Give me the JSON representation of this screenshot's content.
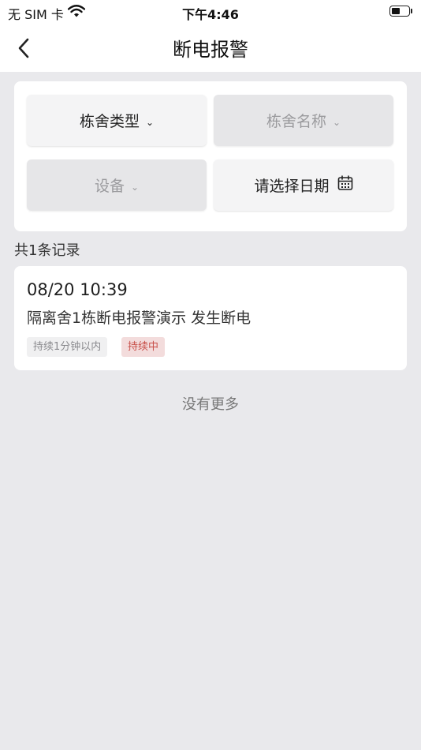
{
  "status_bar": {
    "carrier": "无 SIM 卡",
    "time": "下午4:46"
  },
  "nav": {
    "title": "断电报警"
  },
  "filters": {
    "building_type": "栋舍类型",
    "building_name": "栋舍名称",
    "device": "设备",
    "date": "请选择日期"
  },
  "summary": {
    "count_text": "共1条记录"
  },
  "records": [
    {
      "time": "08/20 10:39",
      "description": "隔离舍1栋断电报警演示 发生断电",
      "duration_tag": "持续1分钟以内",
      "status_tag": "持续中"
    }
  ],
  "footer": {
    "no_more": "没有更多"
  },
  "colors": {
    "background": "#e9e9ec",
    "card": "#ffffff",
    "status_red": "#c8504a"
  }
}
